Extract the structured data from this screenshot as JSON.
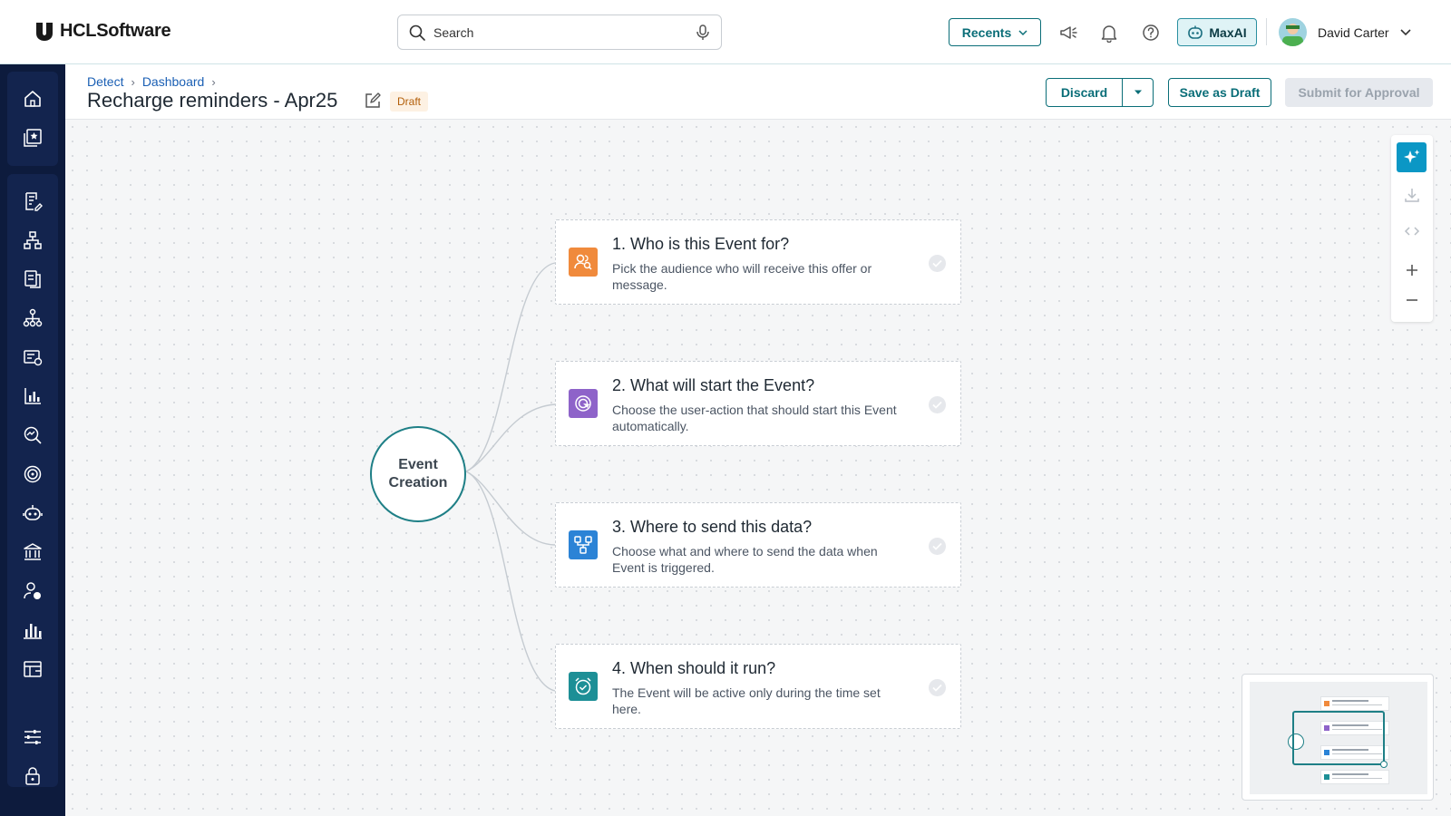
{
  "header": {
    "brand": "HCLSoftware",
    "search_placeholder": "Search",
    "recents_label": "Recents",
    "maxai_label": "MaxAI",
    "user_name": "David Carter"
  },
  "breadcrumb": {
    "items": [
      "Detect",
      "Dashboard"
    ]
  },
  "page": {
    "title": "Recharge reminders - Apr25",
    "status_badge": "Draft"
  },
  "actions": {
    "discard": "Discard",
    "save_draft": "Save as Draft",
    "submit": "Submit for Approval"
  },
  "flow": {
    "root_line1": "Event",
    "root_line2": "Creation",
    "steps": [
      {
        "title": "1. Who is this Event for?",
        "desc": "Pick the audience who will receive this offer or message.",
        "icon": "audience-icon",
        "color": "#f08a3c"
      },
      {
        "title": "2. What will start the Event?",
        "desc": "Choose the user-action that should start this Event automatically.",
        "icon": "trigger-icon",
        "color": "#8e63c9"
      },
      {
        "title": "3. Where to send this data?",
        "desc": "Choose what and where to send the data when Event is triggered.",
        "icon": "destination-icon",
        "color": "#2b83d6"
      },
      {
        "title": "4. When should it run?",
        "desc": "The Event will be active only during the time set here.",
        "icon": "schedule-icon",
        "color": "#1d8f96"
      }
    ]
  },
  "colors": {
    "accent": "#0a6e78",
    "sidebar_bg": "#0d1b3d",
    "ai_button": "#0b97c5"
  }
}
